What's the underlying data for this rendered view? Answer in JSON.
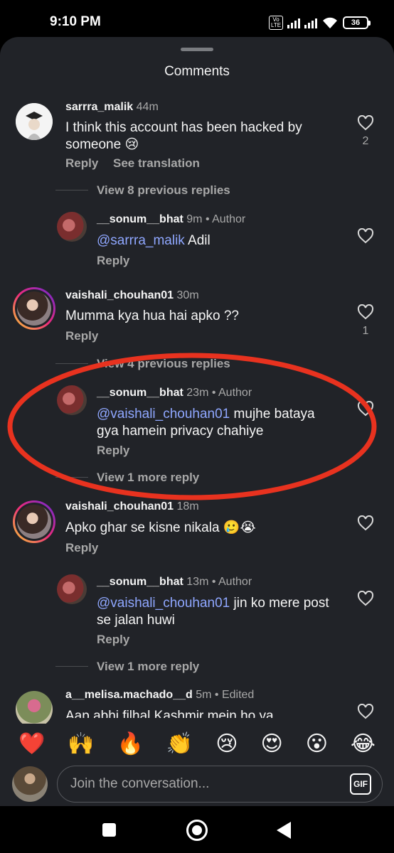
{
  "status_bar": {
    "time": "9:10 PM",
    "volte": "Vo LTE",
    "battery": "36"
  },
  "sheet": {
    "title": "Comments"
  },
  "comments": [
    {
      "user": "sarrra_malik",
      "time": "44m",
      "text": "I think this account has been hacked by someone 😢",
      "reply": "Reply",
      "see_translation": "See translation",
      "likes": "2",
      "view_replies": "View 8 previous replies"
    },
    {
      "user": "__sonum__bhat",
      "time": "9m • Author",
      "mention": "@sarrra_malik",
      "text": " Adil",
      "reply": "Reply"
    },
    {
      "user": "vaishali_chouhan01",
      "time": "30m",
      "text": "Mumma kya hua hai apko ??",
      "reply": "Reply",
      "likes": "1",
      "view_replies": "View 4 previous replies"
    },
    {
      "user": "__sonum__bhat",
      "time": "23m • Author",
      "mention": "@vaishali_chouhan01",
      "text": " mujhe bataya gya hamein privacy chahiye",
      "reply": "Reply",
      "view_replies": "View 1 more reply"
    },
    {
      "user": "vaishali_chouhan01",
      "time": "18m",
      "text": "Apko ghar se kisne nikala 🥲😭",
      "reply": "Reply"
    },
    {
      "user": "__sonum__bhat",
      "time": "13m • Author",
      "mention": "@vaishali_chouhan01",
      "text": " jin ko mere post se jalan huwi",
      "reply": "Reply",
      "view_replies": "View 1 more reply"
    },
    {
      "user": "a__melisa.machado__d",
      "time": "5m • Edited",
      "text": "Aap abhi filhal Kashmir mein ho ya..."
    }
  ],
  "quick_emojis": [
    "❤️",
    "🙌",
    "🔥",
    "👏",
    "😢",
    "😍",
    "😮",
    "😂"
  ],
  "compose": {
    "placeholder": "Join the conversation...",
    "gif_label": "GIF"
  },
  "colors": {
    "background": "#212328",
    "mention": "#8fa7ff",
    "annotation": "#e8321f"
  }
}
